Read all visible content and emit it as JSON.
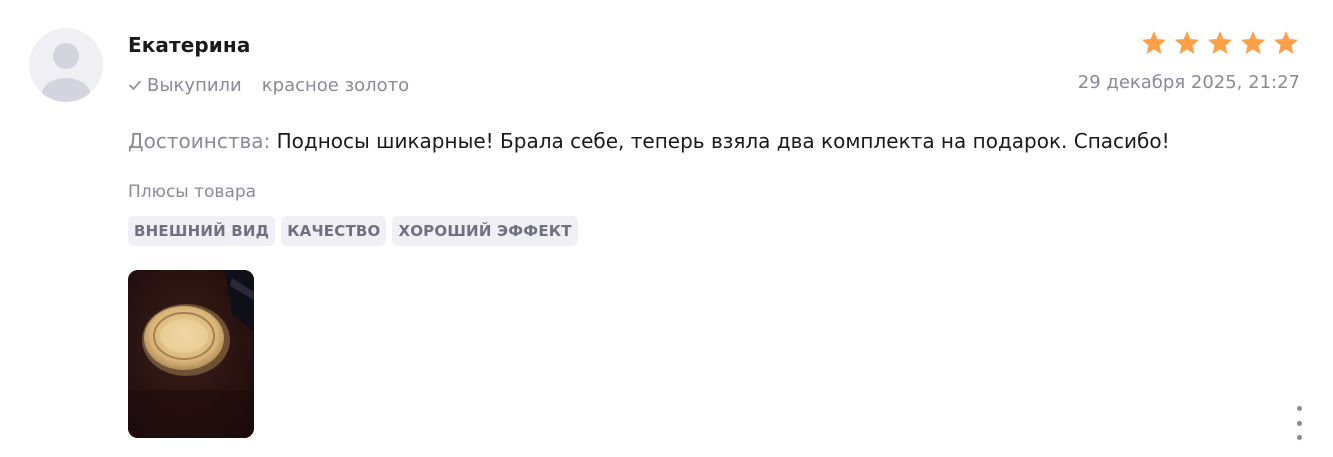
{
  "review": {
    "author_name": "Екатерина",
    "bought_label": "Выкупили",
    "variant": "красное золото",
    "date": "29 декабря 2025, 21:27",
    "rating": 5,
    "pros_label": "Достоинства:",
    "pros_text": "Подносы шикарные! Брала себе, теперь взяла два комплекта на подарок. Спасибо!",
    "plus_title": "Плюсы товара",
    "tags": [
      "ВНЕШНИЙ ВИД",
      "КАЧЕСТВО",
      "ХОРОШИЙ ЭФФЕКТ"
    ]
  },
  "colors": {
    "star": "#ff9f47",
    "muted_text": "#8a8a99",
    "tag_bg": "#f0f0f4"
  },
  "icons": {
    "avatar": "user-avatar-placeholder-icon",
    "check": "check-icon",
    "star": "star-icon",
    "more": "more-vertical-icon"
  }
}
